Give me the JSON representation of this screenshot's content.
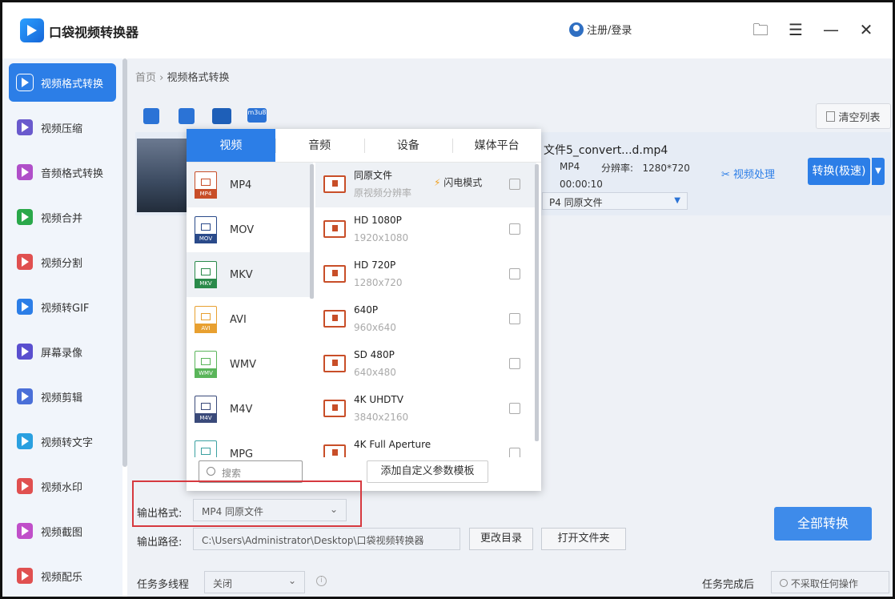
{
  "app": {
    "title": "口袋视频转换器",
    "user_label": "注册/登录"
  },
  "window_controls": {
    "folder": "🗀",
    "menu": "☰",
    "minimize": "—",
    "close": "✕"
  },
  "sidebar": {
    "items": [
      {
        "label": "视频格式转换",
        "color": "#2c7ee7"
      },
      {
        "label": "视频压缩",
        "color": "#6a5acd"
      },
      {
        "label": "音频格式转换",
        "color": "#b04fc9"
      },
      {
        "label": "视频合并",
        "color": "#2aa84a"
      },
      {
        "label": "视频分割",
        "color": "#e05050"
      },
      {
        "label": "视频转GIF",
        "color": "#2c7ee7"
      },
      {
        "label": "屏幕录像",
        "color": "#5a4fcf"
      },
      {
        "label": "视频剪辑",
        "color": "#4a6fd8"
      },
      {
        "label": "视频转文字",
        "color": "#2aa0e0"
      },
      {
        "label": "视频水印",
        "color": "#e05050"
      },
      {
        "label": "视频截图",
        "color": "#c04fc9"
      },
      {
        "label": "视频配乐",
        "color": "#e05050"
      }
    ]
  },
  "breadcrumb": {
    "home": "首页",
    "sep": "›",
    "current": "视频格式转换"
  },
  "toolbar": {
    "clear_label": "清空列表",
    "m3u8_label": "m3u8"
  },
  "file": {
    "name": "文件5_convert...d.mp4",
    "format": "MP4",
    "resolution_label": "分辨率:",
    "resolution": "1280*720",
    "duration": "00:00:10",
    "output_value": "P4  同原文件",
    "process_label": "视频处理",
    "convert_label": "转换(极速)"
  },
  "popup": {
    "tabs": [
      "视频",
      "音频",
      "设备",
      "媒体平台"
    ],
    "containers": [
      {
        "name": "MP4",
        "color": "#c84e28"
      },
      {
        "name": "MOV",
        "color": "#2a4a8a"
      },
      {
        "name": "MKV",
        "color": "#2a8a4a"
      },
      {
        "name": "AVI",
        "color": "#e8a030"
      },
      {
        "name": "WMV",
        "color": "#5ab55a"
      },
      {
        "name": "M4V",
        "color": "#3a4a7a"
      },
      {
        "name": "MPG",
        "color": "#3aa0a0"
      }
    ],
    "presets": [
      {
        "name": "同原文件",
        "sub": "原视频分辨率"
      },
      {
        "name": "HD 1080P",
        "sub": "1920x1080"
      },
      {
        "name": "HD 720P",
        "sub": "1280x720"
      },
      {
        "name": "640P",
        "sub": "960x640"
      },
      {
        "name": "SD 480P",
        "sub": "640x480"
      },
      {
        "name": "4K UHDTV",
        "sub": "3840x2160"
      },
      {
        "name": "4K Full Aperture",
        "sub": ""
      }
    ],
    "flash_mode": "闪电模式",
    "search_placeholder": "搜索",
    "add_template": "添加自定义参数模板"
  },
  "bottom": {
    "output_format_label": "输出格式:",
    "output_format_value": "MP4  同原文件",
    "output_path_label": "输出路径:",
    "output_path_value": "C:\\Users\\Administrator\\Desktop\\口袋视频转换器",
    "change_dir": "更改目录",
    "open_folder": "打开文件夹",
    "convert_all": "全部转换",
    "multithread_label": "任务多线程",
    "multithread_value": "关闭",
    "after_task_label": "任务完成后",
    "after_task_value": "不采取任何操作"
  }
}
